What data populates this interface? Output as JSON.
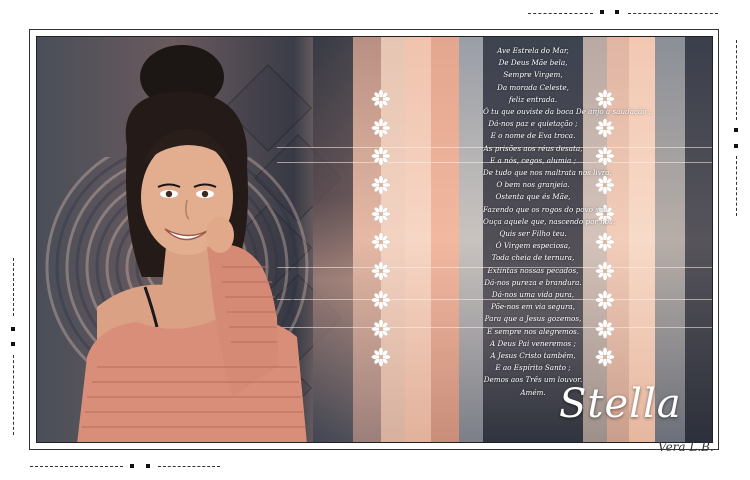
{
  "poem": {
    "lines": [
      "Ave Estrela do Mar,",
      "De Deus Mãe bela,",
      "Sempre Virgem,",
      "Da morada Celeste,",
      "feliz entrada.",
      "Ó tu que ouviste da boca De anjo a saudação ;",
      "Dá-nos paz e quietação ;",
      "E o nome de Eva troca.",
      "As prisões aos réus desata,",
      "E a nós, cegos, alumia ;",
      "De tudo que nos maltrata nos livra,",
      "O bem nos granjeia.",
      "Ostenta que és Mãe,",
      "Fazendo que os rogos do povo seu",
      "Ouça aquele que, nascendo por nós,",
      "Quis ser Filho teu.",
      "Ó Virgem especiosa,",
      "Toda cheia de ternura,",
      "Extintas nossas pecados,",
      "Dá-nos pureza e brandura.",
      "Dá-nos uma vida pura,",
      "Põe-nos em via segura,",
      "Para que a Jesus gozemos,",
      "E sempre nos alegremos.",
      "A Deus Pai veneremos ;",
      "A Jesus Cristo também,",
      "E ao Espírito Santo ;",
      "Demos aos Três um louvor.",
      "Amém."
    ]
  },
  "title": "Stella",
  "signature": "Vera L.B."
}
